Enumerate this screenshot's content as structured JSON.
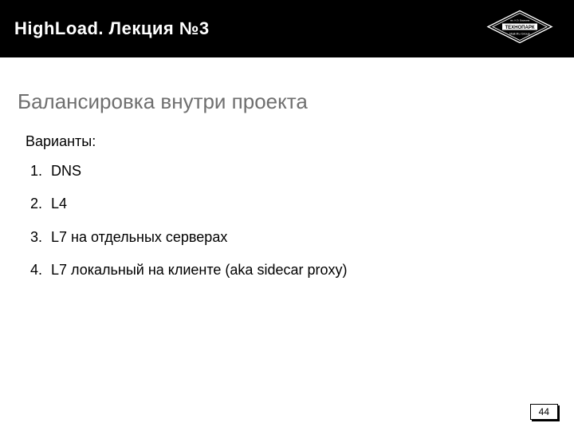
{
  "header": {
    "title": "HighLoad. Лекция №3",
    "logo_top": "ТЕХНОПАРК",
    "logo_bottom": "Mail.Ru Group"
  },
  "section": {
    "title": "Балансировка внутри проекта",
    "options_label": "Варианты:",
    "options": [
      "DNS",
      "L4",
      "L7 на отдельных серверах",
      "L7 локальный на клиенте (aka sidecar proxy)"
    ]
  },
  "page_number": "44"
}
